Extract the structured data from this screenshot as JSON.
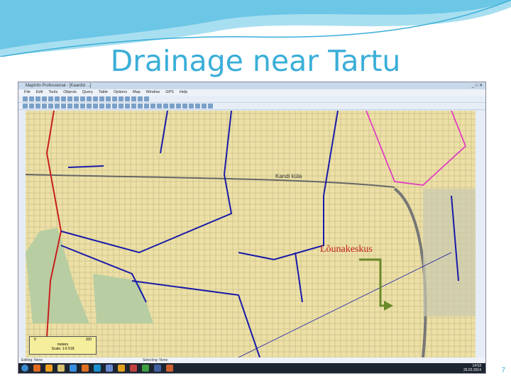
{
  "slide": {
    "title": "Drainage near Tartu",
    "number": "7"
  },
  "window": {
    "title": "MapInfo Professional - [Kaardid ...]",
    "menu": [
      "File",
      "Edit",
      "Tools",
      "Objects",
      "Query",
      "Table",
      "Options",
      "Map",
      "Window",
      "GPS",
      "Help"
    ]
  },
  "map": {
    "labels": {
      "village": "Kandi küla",
      "mall": "Lõunakeskus"
    },
    "scalebar": {
      "start": "0",
      "end": "100",
      "unit": "meters",
      "scale": "Scale: 1:6 518"
    },
    "colors": {
      "drains": "#1a1aa8",
      "red_line": "#c81e1e",
      "pink_line": "#e040c0",
      "arrow": "#6a8a2a"
    }
  },
  "status": {
    "coords": "Editing: None",
    "selecting": "Selecting: None"
  },
  "tray": {
    "time": "14:53",
    "date": "25.02.2014"
  }
}
